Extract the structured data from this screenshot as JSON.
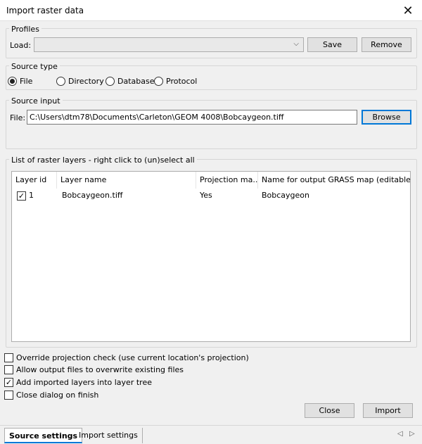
{
  "window": {
    "title": "Import raster data"
  },
  "profiles": {
    "group_label": "Profiles",
    "load_label": "Load:",
    "load_value": "",
    "save_label": "Save",
    "remove_label": "Remove"
  },
  "source_type": {
    "group_label": "Source type",
    "options": [
      "File",
      "Directory",
      "Database",
      "Protocol"
    ],
    "selected": "File"
  },
  "source_input": {
    "group_label": "Source input",
    "file_label": "File:",
    "file_value": "C:\\Users\\dtm78\\Documents\\Carleton\\GEOM 4008\\Bobcaygeon.tiff",
    "browse_label": "Browse"
  },
  "layers": {
    "group_label": "List of raster layers - right click to (un)select all",
    "columns": [
      "Layer id",
      "Layer name",
      "Projection ma...",
      "Name for output GRASS map (editable)"
    ],
    "rows": [
      {
        "checked": true,
        "id": "1",
        "name": "Bobcaygeon.tiff",
        "projection": "Yes",
        "output": "Bobcaygeon"
      }
    ]
  },
  "options": [
    {
      "label": "Override projection check (use current location's projection)",
      "checked": false
    },
    {
      "label": "Allow output files to overwrite existing files",
      "checked": false
    },
    {
      "label": "Add imported layers into layer tree",
      "checked": true
    },
    {
      "label": "Close dialog on finish",
      "checked": false
    }
  ],
  "buttons": {
    "close_label": "Close",
    "import_label": "Import"
  },
  "tabs": [
    {
      "label": "Source settings",
      "active": true
    },
    {
      "label": "Import settings",
      "active": false
    }
  ],
  "icons": {
    "close": "✕",
    "check": "✓",
    "combo_arrow": "⌵",
    "nav_left": "◁",
    "nav_right": "▷"
  }
}
